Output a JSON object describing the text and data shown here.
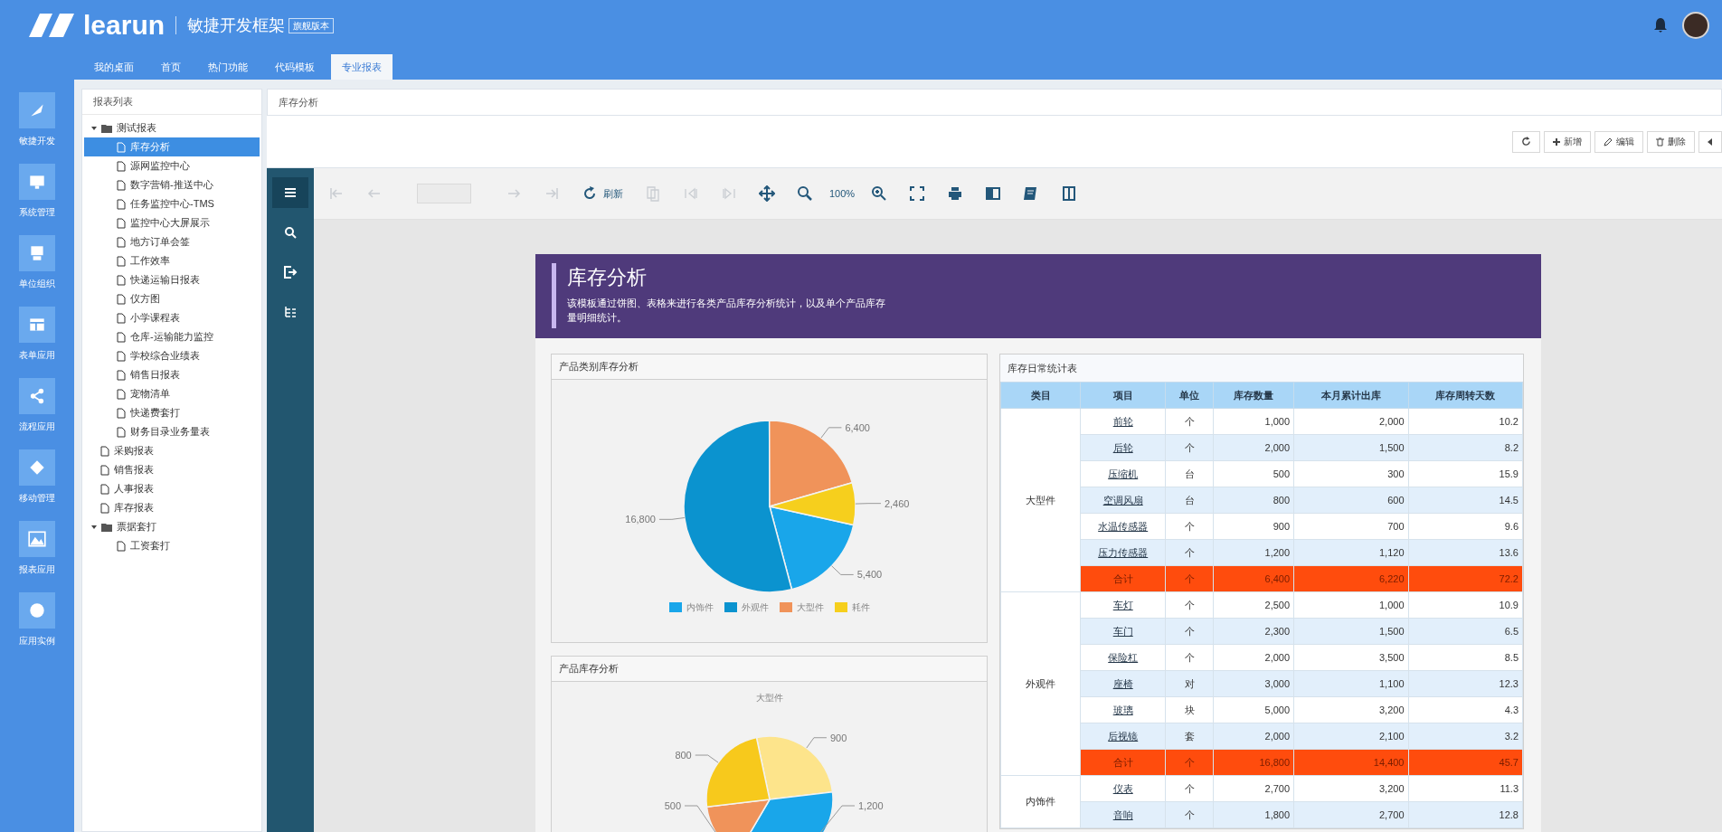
{
  "header": {
    "logo": "learun",
    "title": "敏捷开发框架",
    "edition": "旗舰版本"
  },
  "top_tabs": [
    {
      "label": "我的桌面",
      "selected": false
    },
    {
      "label": "首页",
      "selected": false
    },
    {
      "label": "热门功能",
      "selected": false
    },
    {
      "label": "代码模板",
      "selected": false
    },
    {
      "label": "专业报表",
      "selected": true
    }
  ],
  "nav_sidebar": [
    {
      "kind": "rocket",
      "label": "敏捷开发"
    },
    {
      "kind": "monitor",
      "label": "系统管理"
    },
    {
      "kind": "org",
      "label": "单位组织"
    },
    {
      "kind": "grid",
      "label": "表单应用"
    },
    {
      "kind": "share",
      "label": "流程应用"
    },
    {
      "kind": "diamond",
      "label": "移动管理"
    },
    {
      "kind": "image",
      "label": "报表应用"
    },
    {
      "kind": "globe",
      "label": "应用实例"
    }
  ],
  "report_tree": {
    "title": "报表列表",
    "items": [
      {
        "label": "测试报表",
        "kind": "folder",
        "expanded": true,
        "selected": false,
        "children": [
          {
            "label": "库存分析",
            "kind": "file",
            "selected": true
          },
          {
            "label": "源网监控中心",
            "kind": "file",
            "selected": false
          },
          {
            "label": "数字营销-推送中心",
            "kind": "file",
            "selected": false
          },
          {
            "label": "任务监控中心-TMS",
            "kind": "file",
            "selected": false
          },
          {
            "label": "监控中心大屏展示",
            "kind": "file",
            "selected": false
          },
          {
            "label": "地方订单会签",
            "kind": "file",
            "selected": false
          },
          {
            "label": "工作效率",
            "kind": "file",
            "selected": false
          },
          {
            "label": "快递运输日报表",
            "kind": "file",
            "selected": false
          },
          {
            "label": "仪方图",
            "kind": "file",
            "selected": false
          },
          {
            "label": "小学课程表",
            "kind": "file",
            "selected": false
          },
          {
            "label": "仓库-运输能力监控",
            "kind": "file",
            "selected": false
          },
          {
            "label": "学校综合业绩表",
            "kind": "file",
            "selected": false
          },
          {
            "label": "销售日报表",
            "kind": "file",
            "selected": false
          },
          {
            "label": "宠物清单",
            "kind": "file",
            "selected": false
          },
          {
            "label": "快递费套打",
            "kind": "file",
            "selected": false
          },
          {
            "label": "财务目录业务量表",
            "kind": "file",
            "selected": false
          }
        ]
      },
      {
        "label": "采购报表",
        "kind": "file",
        "selected": false
      },
      {
        "label": "销售报表",
        "kind": "file",
        "selected": false
      },
      {
        "label": "人事报表",
        "kind": "file",
        "selected": false
      },
      {
        "label": "库存报表",
        "kind": "file",
        "selected": false
      },
      {
        "label": "票据套打",
        "kind": "folder",
        "expanded": true,
        "selected": false,
        "children": [
          {
            "label": "工资套打",
            "kind": "file",
            "selected": false
          }
        ]
      }
    ]
  },
  "breadcrumb": "库存分析",
  "actions": [
    {
      "kind": "refresh"
    },
    {
      "kind": "add",
      "label": "新增"
    },
    {
      "kind": "edit",
      "label": "编辑"
    },
    {
      "kind": "delete",
      "label": "删除"
    },
    {
      "kind": "more"
    }
  ],
  "viewer_side": [
    {
      "kind": "menu",
      "selected": true
    },
    {
      "kind": "search",
      "selected": false
    },
    {
      "kind": "export",
      "selected": false
    },
    {
      "kind": "tree",
      "selected": false
    }
  ],
  "viewer_toolbar": [
    {
      "kind": "first",
      "disabled": true
    },
    {
      "kind": "prev",
      "disabled": true
    },
    {
      "kind": "page",
      "disabled": true
    },
    {
      "kind": "next",
      "disabled": true
    },
    {
      "kind": "last",
      "disabled": true
    },
    {
      "kind": "refresh",
      "label": "刷新",
      "disabled": false
    },
    {
      "kind": "copy",
      "disabled": true
    },
    {
      "kind": "prev-section",
      "disabled": true
    },
    {
      "kind": "next-section",
      "disabled": true
    },
    {
      "kind": "move",
      "disabled": false
    },
    {
      "kind": "zoom-out",
      "disabled": false
    },
    {
      "kind": "zoom",
      "label": "100%",
      "disabled": false
    },
    {
      "kind": "zoom-in",
      "disabled": false
    },
    {
      "kind": "fit",
      "disabled": false
    },
    {
      "kind": "print",
      "disabled": false
    },
    {
      "kind": "layout",
      "disabled": false
    },
    {
      "kind": "export",
      "disabled": false
    },
    {
      "kind": "book",
      "disabled": false
    }
  ],
  "report": {
    "title": "库存分析",
    "description": "该模板通过饼图、表格来进行各类产品库存分析统计，以及单个产品库存量明细统计。",
    "category_panel": {
      "title": "产品类别库存分析",
      "chart_data": {
        "type": "pie",
        "categories": [
          "内饰件",
          "外观件",
          "大型件",
          "耗件"
        ],
        "values": [
          5400,
          16800,
          6400,
          2460
        ],
        "value_labels": [
          "5,400",
          "16,800",
          "6,400",
          "2,460"
        ],
        "data_labels": true,
        "legend": "bottom"
      }
    },
    "product_panel": {
      "title": "产品库存分析",
      "chart_data": {
        "type": "pie",
        "title": "大型件",
        "values": [
          900,
          1200,
          500,
          800
        ],
        "value_labels": [
          "900",
          "1,200",
          "500",
          "800"
        ],
        "data_labels": true
      }
    },
    "table": {
      "title": "库存日常统计表",
      "columns": [
        "类目",
        "项目",
        "单位",
        "库存数量",
        "本月累计出库",
        "库存周转天数"
      ],
      "groups": [
        {
          "category": "大型件",
          "rows": [
            {
              "kind": "item",
              "cells": [
                "前轮",
                "个",
                "1,000",
                "2,000",
                "10.2"
              ]
            },
            {
              "kind": "item",
              "cells": [
                "后轮",
                "个",
                "2,000",
                "1,500",
                "8.2"
              ]
            },
            {
              "kind": "item",
              "cells": [
                "压缩机",
                "台",
                "500",
                "300",
                "15.9"
              ]
            },
            {
              "kind": "item",
              "cells": [
                "空调风扇",
                "台",
                "800",
                "600",
                "14.5"
              ]
            },
            {
              "kind": "item",
              "cells": [
                "水温传感器",
                "个",
                "900",
                "700",
                "9.6"
              ]
            },
            {
              "kind": "item",
              "cells": [
                "压力传感器",
                "个",
                "1,200",
                "1,120",
                "13.6"
              ]
            },
            {
              "kind": "total",
              "cells": [
                "合计",
                "个",
                "6,400",
                "6,220",
                "72.2"
              ]
            }
          ]
        },
        {
          "category": "外观件",
          "rows": [
            {
              "kind": "item",
              "cells": [
                "车灯",
                "个",
                "2,500",
                "1,000",
                "10.9"
              ]
            },
            {
              "kind": "item",
              "cells": [
                "车门",
                "个",
                "2,300",
                "1,500",
                "6.5"
              ]
            },
            {
              "kind": "item",
              "cells": [
                "保险杠",
                "个",
                "2,000",
                "3,500",
                "8.5"
              ]
            },
            {
              "kind": "item",
              "cells": [
                "座椅",
                "对",
                "3,000",
                "1,100",
                "12.3"
              ]
            },
            {
              "kind": "item",
              "cells": [
                "玻璃",
                "块",
                "5,000",
                "3,200",
                "4.3"
              ]
            },
            {
              "kind": "item",
              "cells": [
                "后视镜",
                "套",
                "2,000",
                "2,100",
                "3.2"
              ]
            },
            {
              "kind": "total",
              "cells": [
                "合计",
                "个",
                "16,800",
                "14,400",
                "45.7"
              ]
            }
          ]
        },
        {
          "category": "内饰件",
          "rows": [
            {
              "kind": "item",
              "cells": [
                "仪表",
                "个",
                "2,700",
                "3,200",
                "11.3"
              ]
            },
            {
              "kind": "item",
              "cells": [
                "音响",
                "个",
                "1,800",
                "2,700",
                "12.8"
              ]
            }
          ]
        }
      ]
    }
  }
}
